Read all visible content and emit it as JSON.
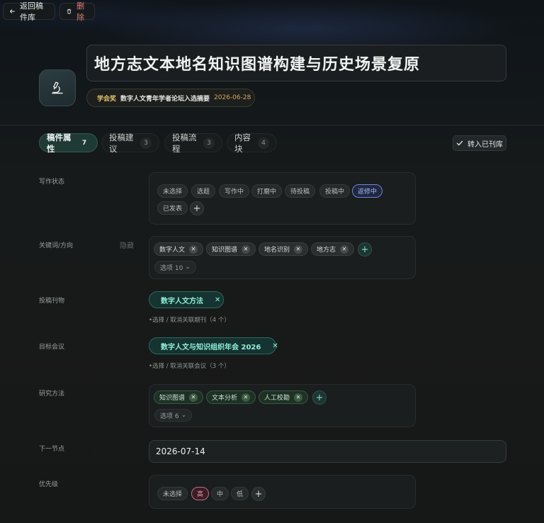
{
  "toolbar": {
    "back_label": "返回稿件库",
    "delete_label": "删除"
  },
  "header": {
    "title": "地方志文本地名知识图谱构建与历史场景复原",
    "award": "学会奖",
    "venue": "数字人文青年学者论坛入选摘要",
    "date": "2026-06-28",
    "app_icon": "microscope-icon"
  },
  "tabs": [
    {
      "label": "稿件属性",
      "count": "7",
      "active": true
    },
    {
      "label": "投稿建议",
      "count": "3",
      "active": false
    },
    {
      "label": "投稿流程",
      "count": "3",
      "active": false
    },
    {
      "label": "内容块",
      "count": "4",
      "active": false
    }
  ],
  "move_button": {
    "label": "转入已刊库"
  },
  "fields": {
    "writing_status": {
      "label": "写作状态",
      "options": [
        "未选择",
        "选题",
        "写作中",
        "打磨中",
        "待投稿",
        "投稿中",
        "返修中",
        "已发表"
      ],
      "selected": "返修中"
    },
    "keywords": {
      "label": "关键词/方向",
      "hide_label": "隐藏",
      "tags": [
        "数字人文",
        "知识图谱",
        "地名识别",
        "地方志"
      ],
      "more_label": "选项 10"
    },
    "journal": {
      "label": "投稿刊物",
      "value": "数字人文方法",
      "hint": "•选择 / 取消关联期刊（4 个）"
    },
    "conference": {
      "label": "目标会议",
      "value": "数字人文与知识组织年会 2026",
      "hint": "•选择 / 取消关联会议（3 个）"
    },
    "methods": {
      "label": "研究方法",
      "tags": [
        "知识图谱",
        "文本分析",
        "人工校勘"
      ],
      "more_label": "选项 6"
    },
    "next_node": {
      "label": "下一节点",
      "value": "2026-07-14"
    },
    "priority": {
      "label": "优先级",
      "options": [
        "未选择",
        "高",
        "中",
        "低"
      ],
      "selected": "高"
    }
  },
  "colors": {
    "accent_teal": "#2b6b60",
    "selected_blue": "#6f85d8",
    "priority_high": "#c96a85",
    "award_gold": "#e2c36a"
  }
}
